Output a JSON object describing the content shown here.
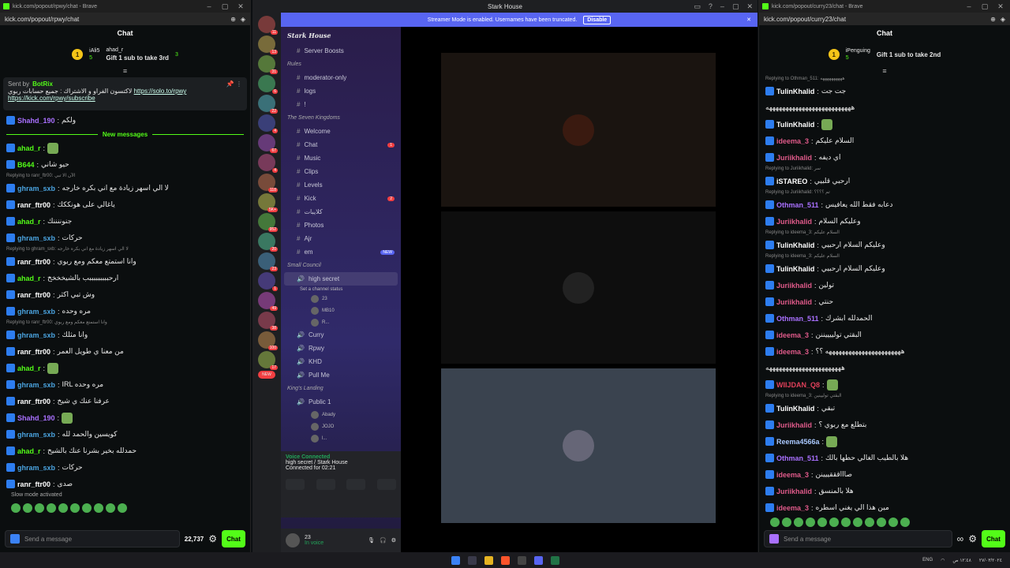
{
  "left": {
    "window_title": "kick.com/popout/rpwy/chat - Brave",
    "url": "kick.com/popout/rpwy/chat",
    "chat_title": "Chat",
    "gifters": [
      {
        "rank": "1",
        "name": "iAli5",
        "count": "5"
      },
      {
        "rank": "",
        "name": "ahad_r",
        "count": "3"
      }
    ],
    "gift_prompt": "Gift 1 sub to take 3rd",
    "pinned": {
      "sent_by": "Sent by",
      "bot": "BotRix",
      "text": "لاكتسون الفراو و الاشتراك : جميع حسابات ربوي",
      "link1": "https://solo.to/rpwy",
      "link2": "https://kick.com/rpwy/subscribe"
    },
    "new_messages": "New messages",
    "messages": [
      {
        "reply": "",
        "user": "Shahd_190",
        "color": "#a970ff",
        "text": "ولكم"
      },
      {
        "reply": "",
        "user": "ahad_r",
        "color": "#53fc18",
        "text": ""
      },
      {
        "reply": "",
        "user": "B644",
        "color": "#53fc18",
        "text": "حيو شاني"
      },
      {
        "reply": "Replying to ranr_ftr00: الآن الا تبي",
        "user": "ghram_sxb",
        "color": "#4aa3df",
        "text": "لا الي اسهر زيادة مع اني بكره خارجه"
      },
      {
        "reply": "",
        "user": "ranr_ftr00",
        "color": "#ffffff",
        "text": "ياغالي على هونككك"
      },
      {
        "reply": "",
        "user": "ahad_r",
        "color": "#53fc18",
        "text": "جنوننننك"
      },
      {
        "reply": "",
        "user": "ghram_sxb",
        "color": "#4aa3df",
        "text": "حركات"
      },
      {
        "reply": "Replying to ghram_sxb: لا الي اسهر زيادة مع اني بكره خارجه",
        "user": "ranr_ftr00",
        "color": "#ffffff",
        "text": "وانا استمتع معكم ومع ربوي"
      },
      {
        "reply": "",
        "user": "ahad_r",
        "color": "#53fc18",
        "text": "ارحبببببببببب بالشيخخخخ"
      },
      {
        "reply": "",
        "user": "ranr_ftr00",
        "color": "#ffffff",
        "text": "وش تبي اكثر"
      },
      {
        "reply": "",
        "user": "ghram_sxb",
        "color": "#4aa3df",
        "text": "مره وحده"
      },
      {
        "reply": "Replying to ranr_ftr00: وانا استمتع معكم ومع ربوي",
        "user": "ghram_sxb",
        "color": "#4aa3df",
        "text": "وانا مثلك"
      },
      {
        "reply": "",
        "user": "ranr_ftr00",
        "color": "#ffffff",
        "text": "من معنا ي طويل العمر"
      },
      {
        "reply": "",
        "user": "ahad_r",
        "color": "#53fc18",
        "text": ""
      },
      {
        "reply": "",
        "user": "ghram_sxb",
        "color": "#4aa3df",
        "text": "IRL مره وحده"
      },
      {
        "reply": "",
        "user": "ranr_ftr00",
        "color": "#ffffff",
        "text": "عرفنا عنك ي شيخ"
      },
      {
        "reply": "",
        "user": "Shahd_190",
        "color": "#a970ff",
        "text": ""
      },
      {
        "reply": "",
        "user": "ghram_sxb",
        "color": "#4aa3df",
        "text": "كويسين والحمد لله"
      },
      {
        "reply": "",
        "user": "ahad_r",
        "color": "#53fc18",
        "text": "حمدلله بخير بشرنا عنك بالشيخ"
      },
      {
        "reply": "",
        "user": "ghram_sxb",
        "color": "#4aa3df",
        "text": "حركات"
      },
      {
        "reply": "",
        "user": "ranr_ftr00",
        "color": "#ffffff",
        "text": "صدى"
      }
    ],
    "slow_mode": "Slow mode activated",
    "input_placeholder": "Send a message",
    "points": "22,737",
    "chat_button": "Chat"
  },
  "mid": {
    "window_title": "Stark House",
    "banner": "Streamer Mode is enabled. Usernames have been truncated.",
    "banner_button": "Disable",
    "server_name": "Stark House",
    "server_badges": [
      "11",
      "13",
      "31",
      "6",
      "22",
      "4",
      "67",
      "4",
      "118",
      "5K+",
      "952",
      "20",
      "23",
      "1",
      "49",
      "38",
      "100",
      "17"
    ],
    "new_label": "NEW",
    "channels": [
      {
        "type": "ch",
        "label": "Server Boosts",
        "badge": ""
      },
      {
        "type": "cat",
        "label": "Rules",
        "badge": ""
      },
      {
        "type": "ch",
        "label": "moderator-only",
        "badge": ""
      },
      {
        "type": "ch",
        "label": "logs",
        "badge": ""
      },
      {
        "type": "ch",
        "label": "!",
        "badge": ""
      },
      {
        "type": "cat",
        "label": "The Seven Kingdoms",
        "badge": ""
      },
      {
        "type": "ch",
        "label": "Welcome",
        "badge": ""
      },
      {
        "type": "ch",
        "label": "Chat",
        "badge": "1"
      },
      {
        "type": "ch",
        "label": "Music",
        "badge": ""
      },
      {
        "type": "ch",
        "label": "Clips",
        "badge": ""
      },
      {
        "type": "ch",
        "label": "Levels",
        "badge": ""
      },
      {
        "type": "ch",
        "label": "Kick",
        "badge": "2"
      },
      {
        "type": "ch",
        "label": "كلايبات",
        "badge": ""
      },
      {
        "type": "ch",
        "label": "Photos",
        "badge": ""
      },
      {
        "type": "ch",
        "label": "Ajr",
        "badge": ""
      },
      {
        "type": "ch",
        "label": "em",
        "badge": "NEW"
      },
      {
        "type": "cat",
        "label": "Small Council",
        "badge": ""
      }
    ],
    "voice_selected": {
      "label": "high secret",
      "status": "Set a channel status"
    },
    "voice_users": [
      "23",
      "MB10",
      "R..."
    ],
    "voice_channels": [
      "Curry",
      "Rpwy",
      "KHD",
      "Pull Me"
    ],
    "kings_landing": "King's Landing",
    "public_channel": "Public 1",
    "public_users": [
      "Abady",
      "JOJO",
      "l..."
    ],
    "voice_connected": "Voice Connected",
    "voice_location": "high secret / Stark House",
    "connected_for": "Connected for 02:21",
    "user": {
      "name": "23",
      "status": "In voice"
    }
  },
  "right": {
    "window_title": "kick.com/popout/curry23/chat - Brave",
    "url": "kick.com/popout/curry23/chat",
    "chat_title": "Chat",
    "gifter": {
      "rank": "1",
      "name": "iPenguing",
      "count": "5"
    },
    "gift_prompt": "Gift 1 sub to take 2nd",
    "messages": [
      {
        "reply": "Replying to Othman_511: ههههههههههه",
        "user": "TulinKhalid",
        "color": "#ffffff",
        "text": "جت جت"
      },
      {
        "reply": "",
        "user": "",
        "color": "#ffffff",
        "text": "ههههههههههههههههههههههههههه"
      },
      {
        "reply": "",
        "user": "TulinKhalid",
        "color": "#ffffff",
        "text": ""
      },
      {
        "reply": "",
        "user": "ideema_3",
        "color": "#e05a8a",
        "text": "السلام عليكم"
      },
      {
        "reply": "",
        "user": "Juriikhalid",
        "color": "#e05a8a",
        "text": "اي ديفه"
      },
      {
        "reply": "Replying to Juriikhalid: سر",
        "user": "iSTAREO",
        "color": "#ffffff",
        "text": "ارحبي قلبيي"
      },
      {
        "reply": "Replying to Juriikhalid: تم ؟؟؟؟",
        "user": "Othman_511",
        "color": "#a970ff",
        "text": "دعابه فقط الله يعافيس"
      },
      {
        "reply": "",
        "user": "Juriikhalid",
        "color": "#e05a8a",
        "text": "وعليكم السلام"
      },
      {
        "reply": "Replying to ideema_3: السلام عليكم",
        "user": "TulinKhalid",
        "color": "#ffffff",
        "text": "وعليكم السلام ارحبيي"
      },
      {
        "reply": "Replying to ideema_3: السلام عليكم",
        "user": "TulinKhalid",
        "color": "#ffffff",
        "text": "وعليكم السلام ارحبيي"
      },
      {
        "reply": "",
        "user": "Juriikhalid",
        "color": "#e05a8a",
        "text": "تولين"
      },
      {
        "reply": "",
        "user": "Juriikhalid",
        "color": "#e05a8a",
        "text": "حنتي"
      },
      {
        "reply": "",
        "user": "Othman_511",
        "color": "#a970ff",
        "text": "الحمدلله ابشرك"
      },
      {
        "reply": "",
        "user": "ideema_3",
        "color": "#e05a8a",
        "text": "البقتي تولييييننن"
      },
      {
        "reply": "",
        "user": "ideema_3",
        "color": "#e05a8a",
        "text": "هههههههههههههههههههههههه ؟؟"
      },
      {
        "reply": "",
        "user": "",
        "color": "#ffffff",
        "text": "هههههههههههههههههههههههه"
      },
      {
        "reply": "",
        "user": "WIIJDAN_Q8",
        "color": "#e0405a",
        "text": ""
      },
      {
        "reply": "Replying to ideema_3: البقتي توليينين",
        "user": "TulinKhalid",
        "color": "#ffffff",
        "text": "تبقي"
      },
      {
        "reply": "",
        "user": "Juriikhalid",
        "color": "#e05a8a",
        "text": "بتطلع مع ربوي ؟"
      },
      {
        "reply": "",
        "user": "Reema4566a",
        "color": "#a9c8ff",
        "text": ""
      },
      {
        "reply": "",
        "user": "Othman_511",
        "color": "#a970ff",
        "text": "هلا بالطيب الغالي حطها بالك"
      },
      {
        "reply": "",
        "user": "ideema_3",
        "color": "#e05a8a",
        "text": "صاااقققييينن"
      },
      {
        "reply": "",
        "user": "Juriikhalid",
        "color": "#e05a8a",
        "text": "هلا بالمنسق"
      },
      {
        "reply": "",
        "user": "ideema_3",
        "color": "#e05a8a",
        "text": "مين هذا الي يغني اسطره"
      }
    ],
    "input_placeholder": "Send a message",
    "chat_button": "Chat"
  },
  "taskbar": {
    "lang": "ENG",
    "time": "١٢:٤٨ ص",
    "date": "٢٧/٠٣/٢٠٢٤"
  }
}
